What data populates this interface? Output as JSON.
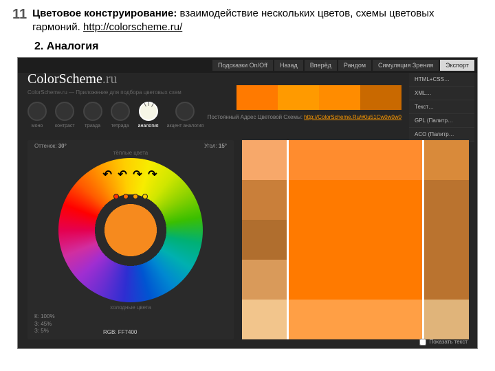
{
  "slide": {
    "number": "11",
    "title_bold": "Цветовое конструирование:",
    "title_rest": " взаимодействие нескольких цветов, схемы цветовых гармоний. ",
    "url": "http://colorscheme.ru/",
    "subtitle": "2. Аналогия"
  },
  "topbar": {
    "hints": "Подсказки On/Off",
    "back": "Назад",
    "fwd": "Вперёд",
    "random": "Рандом",
    "vision": "Симуляция Зрения",
    "export": "Экспорт"
  },
  "export_menu": [
    "HTML+CSS…",
    "XML…",
    "Текст…",
    "GPL (Палитр…",
    "ACO (Палитр…"
  ],
  "brand": {
    "name": "ColorScheme",
    "suffix": ".ru",
    "tag": "ColorScheme.ru — Приложение для подбора цветовых схем"
  },
  "modes": [
    {
      "key": "mono",
      "label": "моно"
    },
    {
      "key": "contrast",
      "label": "контраст"
    },
    {
      "key": "triad",
      "label": "триада"
    },
    {
      "key": "tetrad",
      "label": "тетрада"
    },
    {
      "key": "analog",
      "label": "аналогия"
    },
    {
      "key": "accent",
      "label": "акцент аналогия"
    }
  ],
  "preview_colors": [
    "#ff7a00",
    "#ff9a00",
    "#ff8c00",
    "#c96900"
  ],
  "permalink": {
    "label": "Постоянный Адрес Цветовой Схемы: ",
    "url": "http://ColorScheme.Ru/#0u51Cw0w0w0"
  },
  "wheel": {
    "hue_label": "Оттенок:",
    "hue_val": "30°",
    "angle_label": "Угол:",
    "angle_val": "15°",
    "warm": "тёплые цвета",
    "cold": "холодные цвета"
  },
  "rgb": {
    "r": "К: 100%",
    "g": "З: 45%",
    "b": "З: 5%",
    "hex": "RGB: FF7400"
  },
  "palette": [
    [
      "#f7a86a",
      "#c97f3a",
      "#b06e2e",
      "#d99a5a",
      "#f2c58c"
    ],
    [
      "#ff8c2e",
      "#ff7a00",
      "#ff7a00",
      "#ff7a00",
      "#ff9f45"
    ],
    [
      "#d98a3a",
      "#ba732f",
      "#ba732f",
      "#ba732f",
      "#e0b47a"
    ]
  ],
  "show_text": "Показать текст"
}
